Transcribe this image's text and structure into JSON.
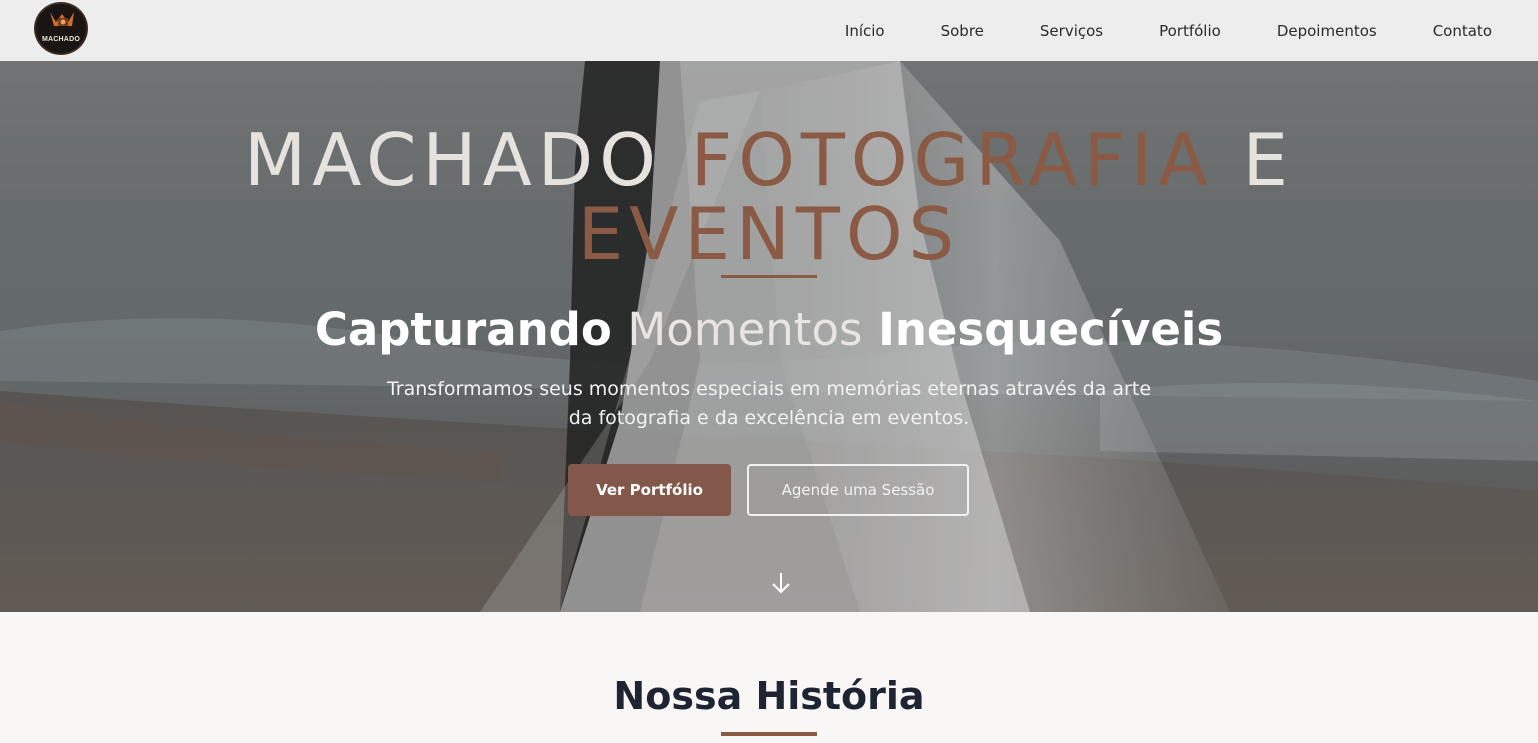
{
  "header": {
    "logo": {
      "text": "MACHADO",
      "icon": "camera-icon"
    },
    "nav": [
      {
        "label": "Início"
      },
      {
        "label": "Sobre"
      },
      {
        "label": "Serviços"
      },
      {
        "label": "Portfólio"
      },
      {
        "label": "Depoimentos"
      },
      {
        "label": "Contato"
      }
    ]
  },
  "hero": {
    "title_part1": "MACHADO",
    "title_part2": "FOTOGRAFIA",
    "title_part3": "E",
    "title_part4": "EVENTOS",
    "subtitle_part1": "Capturando",
    "subtitle_part2": "Momentos",
    "subtitle_part3": "Inesquecíveis",
    "description": "Transformamos seus momentos especiais em memórias eternas através da arte da fotografia e da excelência em eventos.",
    "primary_button": "Ver Portfólio",
    "secondary_button": "Agende uma Sessão",
    "scroll_icon": "arrow-down-icon"
  },
  "history": {
    "title": "Nossa História"
  },
  "colors": {
    "accent": "#8a5a45",
    "button": "#83584a",
    "heading_dark": "#1f2433",
    "background": "#f8f7f6"
  }
}
